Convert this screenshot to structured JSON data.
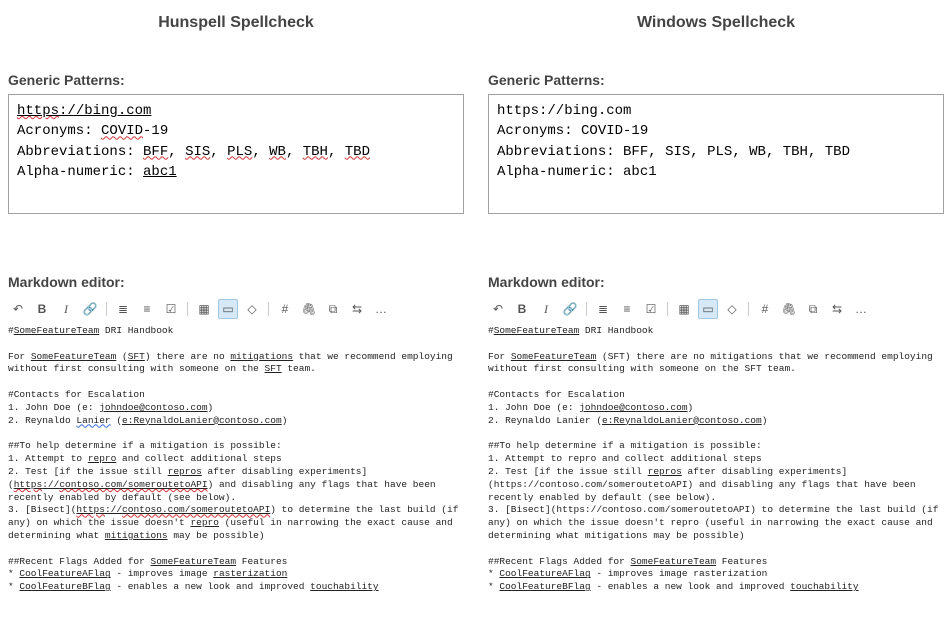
{
  "columns": [
    {
      "id": "hunspell",
      "title": "Hunspell Spellcheck"
    },
    {
      "id": "windows",
      "title": "Windows Spellcheck"
    }
  ],
  "patterns": {
    "heading": "Generic Patterns:",
    "url": "https://bing.com",
    "acronyms_label": "Acronyms: ",
    "acronyms_value": "COVID-19",
    "abbrev_label": "Abbreviations: ",
    "abbrev_values": [
      "BFF",
      "SIS",
      "PLS",
      "WB",
      "TBH",
      "TBD"
    ],
    "alnum_label": "Alpha-numeric: ",
    "alnum_value": "abc1"
  },
  "markdown": {
    "heading": "Markdown editor:",
    "toolbar": {
      "undo": "↶",
      "bold": "B",
      "italic": "I",
      "link": "🔗",
      "ul": "≣",
      "ol": "≡",
      "checklist": "☑",
      "table": "▦",
      "code": "▭",
      "updown": "◇",
      "hash": "#",
      "attach": "🖇",
      "copy": "⧉",
      "toggle": "⇆",
      "more": "…"
    },
    "terms": {
      "SomeFeatureTeam": "SomeFeatureTeam",
      "SFT": "SFT",
      "mitigations": "mitigations",
      "johndoe_email": "johndoe@contoso.com",
      "lanier": "Lanier",
      "reynaldo_email": "e:ReynaldoLanier@contoso.com",
      "repro": "repro",
      "repros": "repros",
      "contoso_route": "https://contoso.com/someroutetoAPI",
      "contoso_link": "contoso.com/someroutetoAPI",
      "CoolFeatureAFlag": "CoolFeatureAFlag",
      "CoolFeatureBFlag": "CoolFeatureBFlag",
      "rasterization": "rasterization",
      "touchability": "touchability"
    },
    "text": {
      "l1a": "#",
      "l1b": " DRI Handbook",
      "p1a": "For ",
      "p1b": " (",
      "p1c": ") there are no ",
      "p1d": " that we recommend employing without first consulting with someone on the ",
      "p1e": " team.",
      "contacts_h": "#Contacts for Escalation",
      "c1a": "1. John Doe (e: ",
      "c1b": ")",
      "c2a": "2. Reynaldo ",
      "c2b": " (",
      "c2c": ")",
      "help_h": "##To help determine if a mitigation is possible:",
      "s1a": "1. Attempt to ",
      "s1b": " and collect additional steps",
      "s2a": "2. Test [if the issue still ",
      "s2b": " after disabling experiments](",
      "s2c": ") and disabling any flags that have been recently enabled by default (see below).",
      "s3a": "3. [Bisect](",
      "s3b": ") to determine the last build (if any) on which the issue doesn't ",
      "s3c": " (useful in narrowing the exact cause and determining what ",
      "s3d": " may be possible)",
      "flags_h_a": "##Recent Flags Added for ",
      "flags_h_b": " Features",
      "f1a": "* ",
      "f1b": " - improves image ",
      "f2a": "* ",
      "f2b": " - enables a new look and improved ",
      "plain": {
        "sft": "(SFT)",
        "mitigations_p": "mitigations",
        "repro_p": "repro",
        "repros_p": "repros",
        "lanier_p": "Lanier",
        "mitigations_p2": "mitigations"
      }
    }
  }
}
